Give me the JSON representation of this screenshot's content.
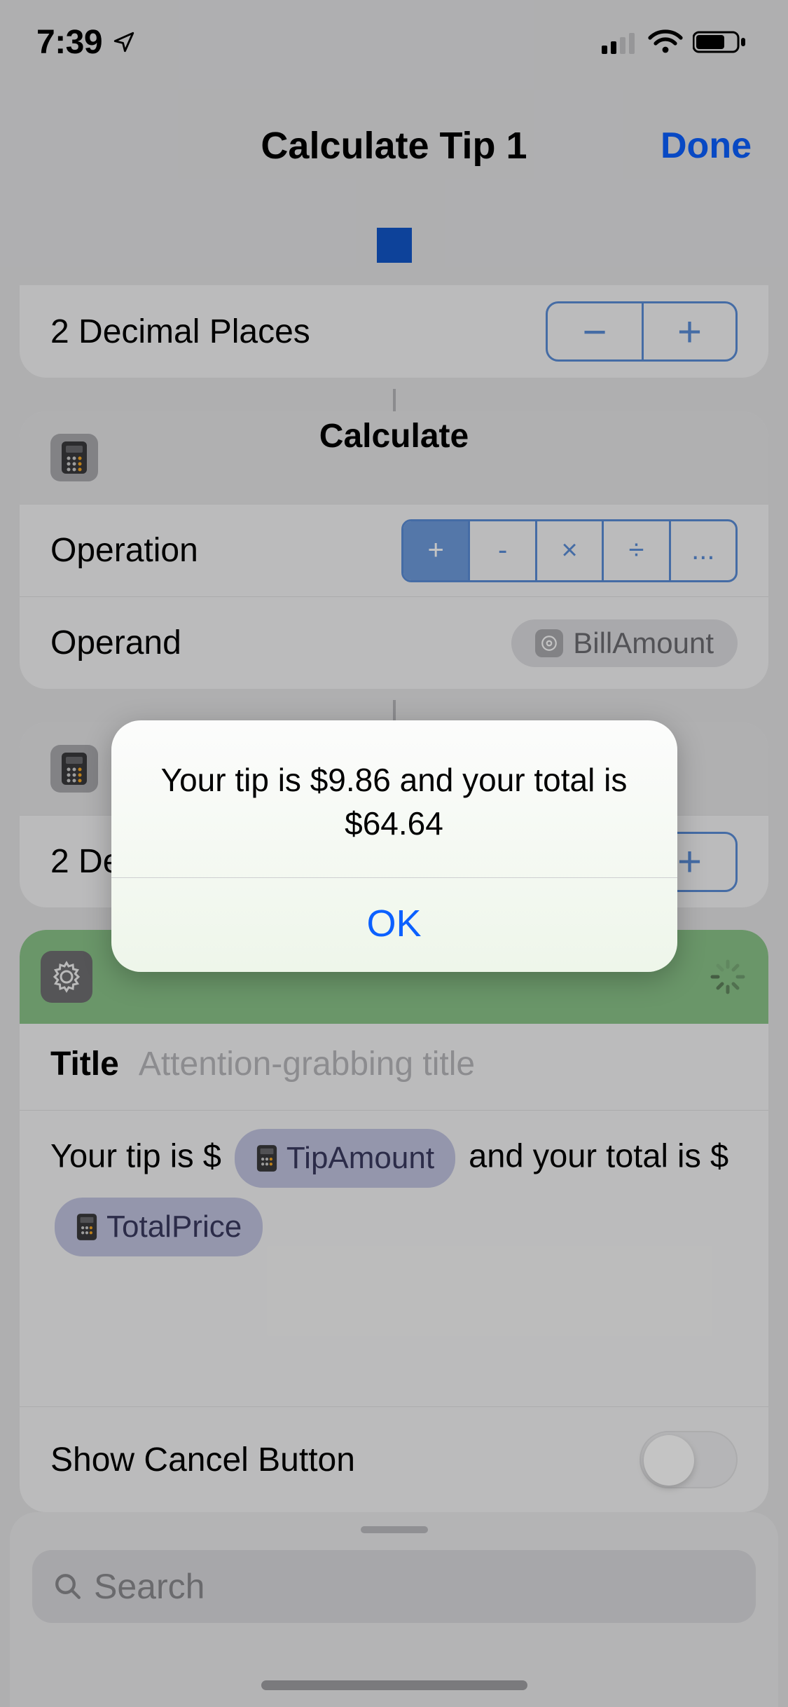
{
  "status": {
    "time": "7:39"
  },
  "header": {
    "title": "Calculate Tip 1",
    "done": "Done"
  },
  "colors": {
    "accent": "#0b60ff",
    "swatch": "#1257c9",
    "green": "#8ac389"
  },
  "card_decimal": {
    "label": "2 Decimal Places",
    "minus": "−",
    "plus": "+"
  },
  "card_calculate": {
    "title": "Calculate",
    "operation_label": "Operation",
    "operations": [
      "+",
      "-",
      "×",
      "÷",
      "..."
    ],
    "operation_selected_index": 0,
    "operand_label": "Operand",
    "operand_token": "BillAmount"
  },
  "card_decimal2": {
    "label_visible": "2 De",
    "plus": "+"
  },
  "card_show_result": {
    "title_label": "Title",
    "title_placeholder": "Attention-grabbing title",
    "body_prefix": "Your tip is $",
    "token1": "TipAmount",
    "body_mid": " and your total is $",
    "token2": "TotalPrice",
    "show_cancel_label": "Show Cancel Button",
    "show_cancel_value": false
  },
  "search": {
    "placeholder": "Search"
  },
  "alert": {
    "message": "Your tip is $9.86 and your total is $64.64",
    "ok": "OK"
  }
}
